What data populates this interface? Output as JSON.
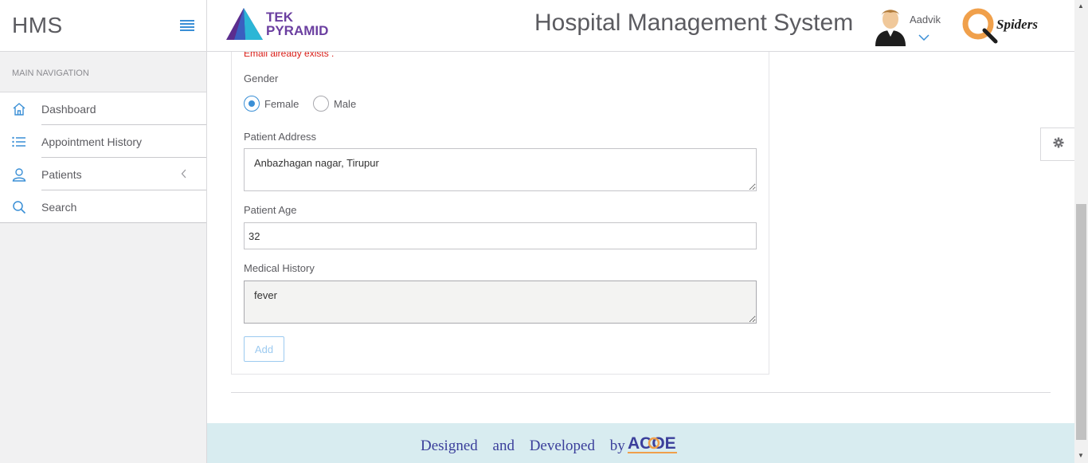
{
  "sidebar": {
    "brand": "HMS",
    "nav_label": "MAIN NAVIGATION",
    "items": [
      {
        "label": "Dashboard",
        "icon": "home-icon"
      },
      {
        "label": "Appointment History",
        "icon": "list-icon"
      },
      {
        "label": "Patients",
        "icon": "user-icon"
      },
      {
        "label": "Search",
        "icon": "search-icon"
      }
    ]
  },
  "header": {
    "logo_line1": "TEK",
    "logo_line2": "PYRAMID",
    "title": "Hospital Management System",
    "user_name": "Aadvik",
    "partner_logo_text": "Spiders"
  },
  "form": {
    "error_message": "Email already exists .",
    "gender_label": "Gender",
    "gender_options": [
      "Female",
      "Male"
    ],
    "gender_selected": "Female",
    "address_label": "Patient Address",
    "address_value": "Anbazhagan nagar, Tirupur",
    "age_label": "Patient Age",
    "age_value": "32",
    "history_label": "Medical History",
    "history_value": "fever",
    "add_button": "Add"
  },
  "footer": {
    "text": "Designed and Developed by",
    "logo_text": "ACOE"
  },
  "colors": {
    "accent": "#3a8fd6",
    "error": "#d9201a",
    "brand_purple": "#6b3fa0",
    "footer_bg": "#d8ecf0",
    "footer_text": "#3b3f9b"
  }
}
